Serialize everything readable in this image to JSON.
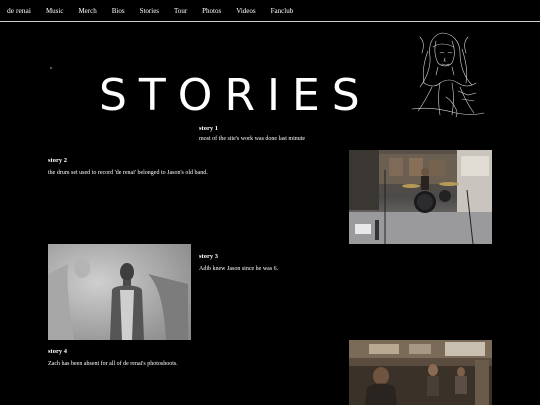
{
  "nav": {
    "brand": "de renai",
    "items": [
      "Music",
      "Merch",
      "Bios",
      "Stories",
      "Tour",
      "Photos",
      "Videos",
      "Fanclub"
    ]
  },
  "hero": {
    "title": "STORIES"
  },
  "stories": [
    {
      "title": "story 1",
      "text": "most of the site's work was done last minute"
    },
    {
      "title": "story 2",
      "text": "the drum set used to record 'de renai' belonged to Jason's old band."
    },
    {
      "title": "story 3",
      "text": "Adib knew Jason since he was 6."
    },
    {
      "title": "story 4",
      "text": "Zach has been absent for all of de renai's photoshoots."
    }
  ]
}
